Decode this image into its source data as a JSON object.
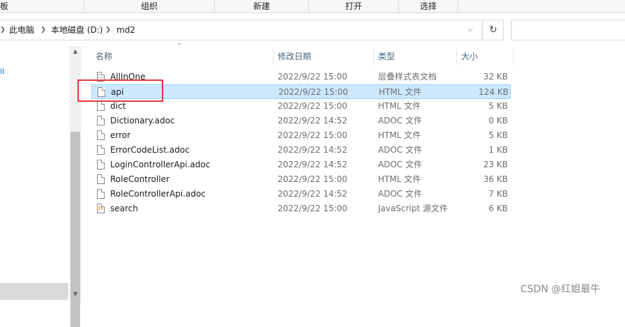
{
  "ribbon": {
    "groups": [
      "板",
      "组织",
      "新建",
      "打开",
      "选择"
    ]
  },
  "address": {
    "crumbs": [
      "此电脑",
      "本地磁盘 (D:)",
      "md2"
    ],
    "search_placeholder": ""
  },
  "columns": {
    "name": "名称",
    "date": "修改日期",
    "type": "类型",
    "size": "大小"
  },
  "files": [
    {
      "name": "AllInOne",
      "date": "2022/9/22 15:00",
      "type": "层叠样式表文档",
      "size": "32 KB",
      "icon": "css-file-icon"
    },
    {
      "name": "api",
      "date": "2022/9/22 15:00",
      "type": "HTML 文件",
      "size": "124 KB",
      "icon": "file-icon",
      "selected": true
    },
    {
      "name": "dict",
      "date": "2022/9/22 15:00",
      "type": "HTML 文件",
      "size": "5 KB",
      "icon": "file-icon"
    },
    {
      "name": "Dictionary.adoc",
      "date": "2022/9/22 14:52",
      "type": "ADOC 文件",
      "size": "0 KB",
      "icon": "file-icon"
    },
    {
      "name": "error",
      "date": "2022/9/22 15:00",
      "type": "HTML 文件",
      "size": "5 KB",
      "icon": "file-icon"
    },
    {
      "name": "ErrorCodeList.adoc",
      "date": "2022/9/22 14:52",
      "type": "ADOC 文件",
      "size": "1 KB",
      "icon": "file-icon"
    },
    {
      "name": "LoginControllerApi.adoc",
      "date": "2022/9/22 14:52",
      "type": "ADOC 文件",
      "size": "23 KB",
      "icon": "file-icon"
    },
    {
      "name": "RoleController",
      "date": "2022/9/22 15:00",
      "type": "HTML 文件",
      "size": "36 KB",
      "icon": "file-icon"
    },
    {
      "name": "RoleControllerApi.adoc",
      "date": "2022/9/22 14:52",
      "type": "ADOC 文件",
      "size": "7 KB",
      "icon": "file-icon"
    },
    {
      "name": "search",
      "date": "2022/9/22 15:00",
      "type": "JavaScript 源文件",
      "size": "6 KB",
      "icon": "js-file-icon"
    }
  ],
  "nav_fragment": "lL",
  "watermark": "CSDN @红姐最牛",
  "colors": {
    "selection_bg": "#cce8ff",
    "selection_border": "#99d1ff",
    "highlight_box": "#e03b3b"
  }
}
